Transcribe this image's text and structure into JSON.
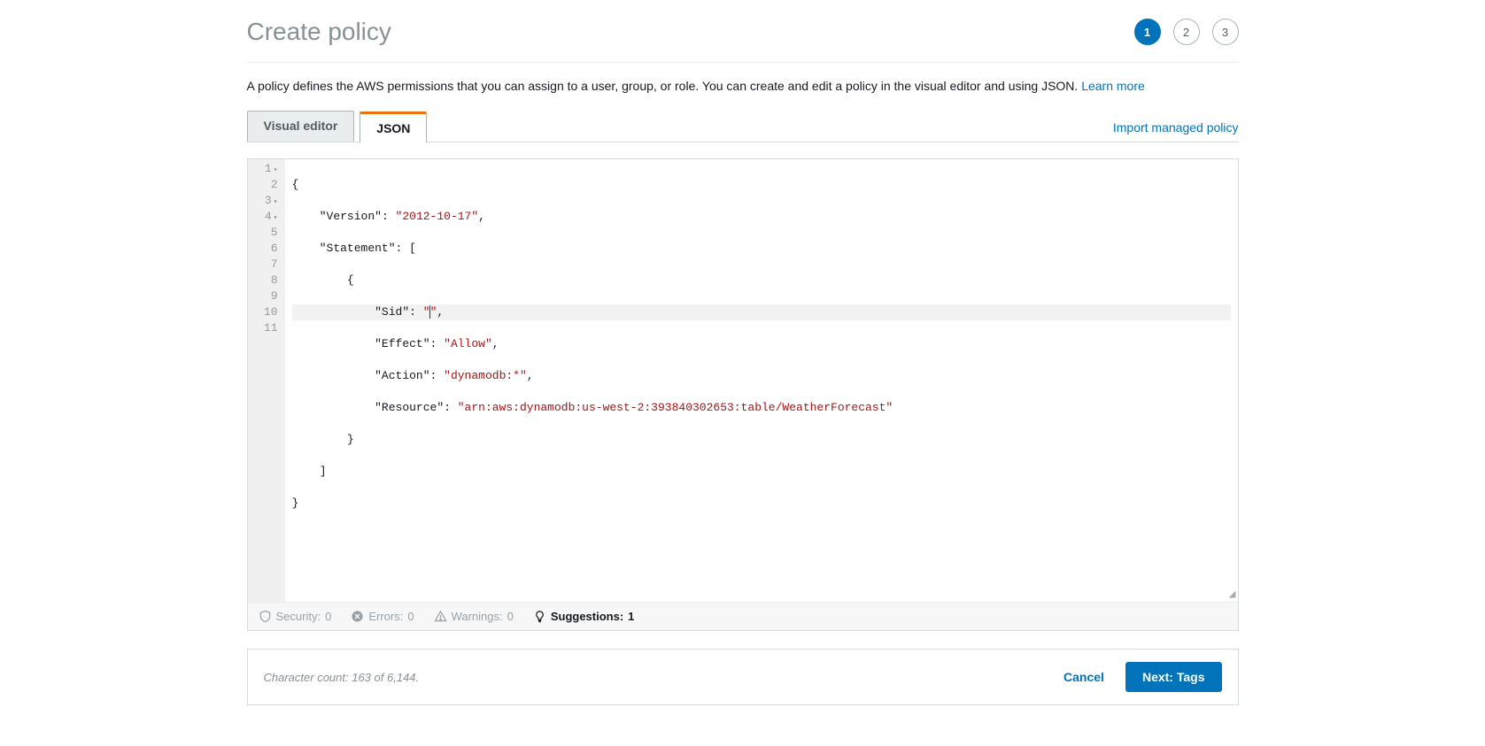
{
  "header": {
    "title": "Create policy",
    "steps": [
      {
        "number": "1",
        "active": true
      },
      {
        "number": "2",
        "active": false
      },
      {
        "number": "3",
        "active": false
      }
    ]
  },
  "description": {
    "text": "A policy defines the AWS permissions that you can assign to a user, group, or role. You can create and edit a policy in the visual editor and using JSON. ",
    "learn_more": "Learn more"
  },
  "tabs": {
    "visual_editor": "Visual editor",
    "json": "JSON",
    "import_link": "Import managed policy"
  },
  "editor": {
    "lines": [
      "1",
      "2",
      "3",
      "4",
      "5",
      "6",
      "7",
      "8",
      "9",
      "10",
      "11"
    ],
    "policy": {
      "Version": "2012-10-17",
      "Statement": [
        {
          "Sid": "",
          "Effect": "Allow",
          "Action": "dynamodb:*",
          "Resource": "arn:aws:dynamodb:us-west-2:393840302653:table/WeatherForecast"
        }
      ]
    },
    "code_tokens": {
      "l1": "{",
      "l2_key": "\"Version\"",
      "l2_val": "\"2012-10-17\"",
      "l3_key": "\"Statement\"",
      "l4": "{",
      "l5_key": "\"Sid\"",
      "l5_val_open": "\"",
      "l5_val_close": "\"",
      "l6_key": "\"Effect\"",
      "l6_val": "\"Allow\"",
      "l7_key": "\"Action\"",
      "l7_val": "\"dynamodb:*\"",
      "l8_key": "\"Resource\"",
      "l8_val": "\"arn:aws:dynamodb:us-west-2:393840302653:table/WeatherForecast\"",
      "l9": "}",
      "l10": "]",
      "l11": "}"
    }
  },
  "status": {
    "security": {
      "label": "Security:",
      "count": "0"
    },
    "errors": {
      "label": "Errors:",
      "count": "0"
    },
    "warnings": {
      "label": "Warnings:",
      "count": "0"
    },
    "suggestions": {
      "label": "Suggestions:",
      "count": "1"
    }
  },
  "footer": {
    "char_count": "Character count: 163 of 6,144.",
    "cancel": "Cancel",
    "next": "Next: Tags"
  }
}
